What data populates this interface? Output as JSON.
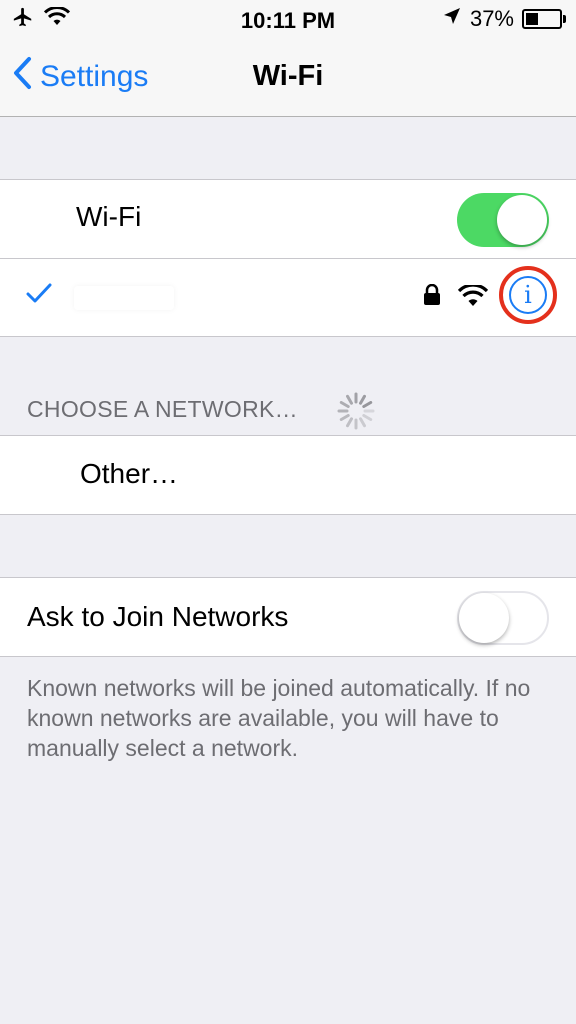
{
  "status_bar": {
    "time": "10:11 PM",
    "battery_text": "37%",
    "battery_level": 0.37,
    "icons": [
      "airplane-icon",
      "wifi-signal-icon",
      "location-arrow-icon",
      "battery-icon"
    ]
  },
  "nav": {
    "back_label": "Settings",
    "title": "Wi-Fi"
  },
  "wifi": {
    "label": "Wi-Fi",
    "enabled": true
  },
  "connected_network": {
    "name": "",
    "secured": true,
    "info_button": "i",
    "info_highlight_color": "#e4301c"
  },
  "networks": {
    "header": "CHOOSE A NETWORK…",
    "other_label": "Other…"
  },
  "ask_to_join": {
    "label": "Ask to Join Networks",
    "enabled": false,
    "footer": "Known networks will be joined automatically. If no known networks are available, you will have to manually select a network."
  },
  "colors": {
    "accent": "#1a7cf5",
    "toggle_on": "#4cd964",
    "highlight": "#e4301c",
    "background": "#efeff4"
  }
}
